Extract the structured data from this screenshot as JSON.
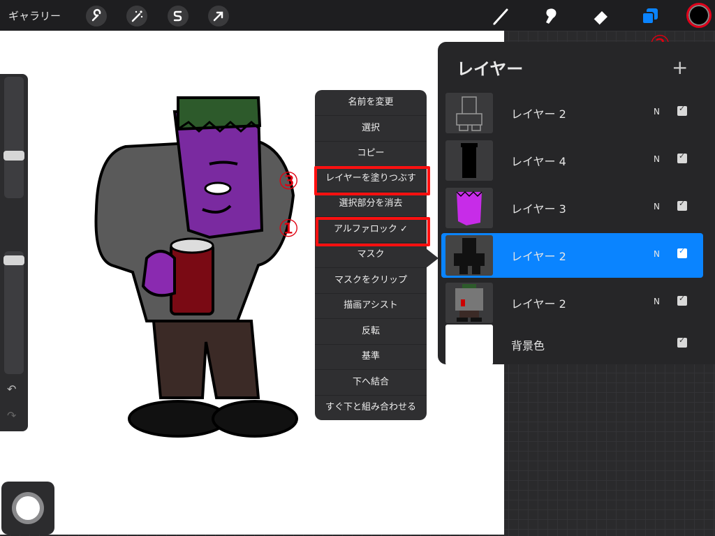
{
  "toolbar": {
    "gallery": "ギャラリー",
    "left_icons": [
      "wrench-icon",
      "magic-wand-icon",
      "selection-s-icon",
      "arrow-transform-icon"
    ],
    "right_icons": [
      "brush-icon",
      "smudge-icon",
      "eraser-icon",
      "layers-icon"
    ],
    "color": "#000000"
  },
  "annotations": {
    "one": "①",
    "two": "②",
    "three": "③",
    "highlight_color": "#ff1010"
  },
  "menu": {
    "items": [
      "名前を変更",
      "選択",
      "コピー",
      "レイヤーを塗りつぶす",
      "選択部分を消去",
      "アルファロック ✓",
      "マスク",
      "マスクをクリップ",
      "描画アシスト",
      "反転",
      "基準",
      "下へ結合",
      "すぐ下と組み合わせる"
    ]
  },
  "layers": {
    "title": "レイヤー",
    "add": "+",
    "items": [
      {
        "name": "レイヤー 2",
        "mode": "N",
        "visible": true,
        "selected": false
      },
      {
        "name": "レイヤー 4",
        "mode": "N",
        "visible": true,
        "selected": false
      },
      {
        "name": "レイヤー 3",
        "mode": "N",
        "visible": true,
        "selected": false
      },
      {
        "name": "レイヤー 2",
        "mode": "N",
        "visible": true,
        "selected": true
      },
      {
        "name": "レイヤー 2",
        "mode": "N",
        "visible": true,
        "selected": false
      },
      {
        "name": "背景色",
        "mode": "",
        "visible": true,
        "selected": false
      }
    ]
  },
  "sidebar": {
    "undo": "↶",
    "redo": "↷"
  },
  "accent": "#0a84ff"
}
